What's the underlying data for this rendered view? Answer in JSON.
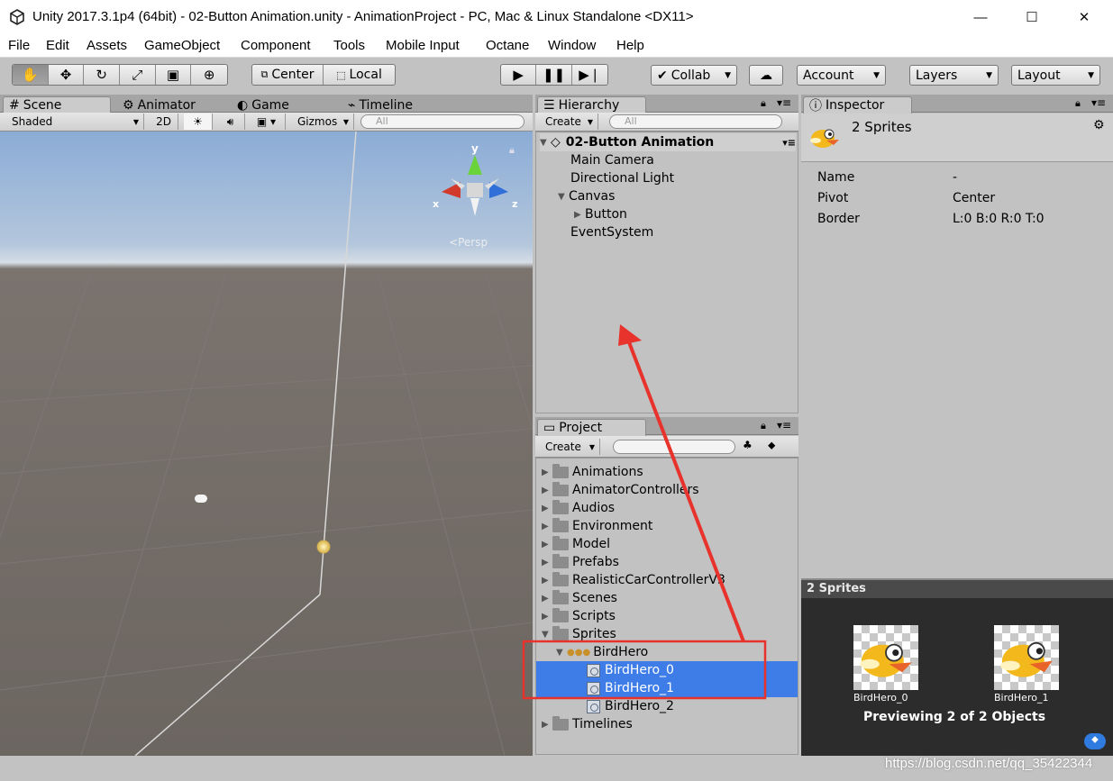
{
  "window": {
    "title": "Unity 2017.3.1p4 (64bit) - 02-Button Animation.unity - AnimationProject - PC, Mac & Linux Standalone <DX11>",
    "minimize": "—",
    "maximize": "☐",
    "close": "✕"
  },
  "menu": [
    "File",
    "Edit",
    "Assets",
    "GameObject",
    "Component",
    "Tools",
    "Mobile Input",
    "Octane",
    "Window",
    "Help"
  ],
  "toolbar": {
    "pivot": "Center",
    "space": "Local",
    "collab": "Collab",
    "account": "Account",
    "layers": "Layers",
    "layout": "Layout"
  },
  "scene": {
    "tabs": [
      "Scene",
      "Animator",
      "Game",
      "Timeline"
    ],
    "shading": "Shaded",
    "mode2d": "2D",
    "gizmos": "Gizmos",
    "search_placeholder": "All",
    "persp": "Persp",
    "axis_y": "y",
    "axis_x": "x",
    "axis_z": "z"
  },
  "hierarchy": {
    "tab": "Hierarchy",
    "create": "Create",
    "search_placeholder": "All",
    "scene_name": "02-Button Animation",
    "items": [
      "Main Camera",
      "Directional Light",
      "Canvas",
      "Button",
      "EventSystem"
    ]
  },
  "project": {
    "tab": "Project",
    "create": "Create",
    "folders": [
      "Animations",
      "AnimatorControllers",
      "Audios",
      "Environment",
      "Model",
      "Prefabs",
      "RealisticCarControllerV3",
      "Scenes",
      "Scripts",
      "Sprites"
    ],
    "sprite_sheet": "BirdHero",
    "sprites": [
      "BirdHero_0",
      "BirdHero_1",
      "BirdHero_2"
    ],
    "last_folder": "Timelines"
  },
  "inspector": {
    "tab": "Inspector",
    "header": "2 Sprites",
    "fields": [
      {
        "label": "Name",
        "value": "-"
      },
      {
        "label": "Pivot",
        "value": "Center"
      },
      {
        "label": "Border",
        "value": "L:0 B:0 R:0 T:0"
      }
    ],
    "preview_title": "2 Sprites",
    "preview_items": [
      "BirdHero_0",
      "BirdHero_1"
    ],
    "preview_caption": "Previewing 2 of 2 Objects"
  },
  "watermark": "https://blog.csdn.net/qq_35422344",
  "colors": {
    "selection": "#3e7de7",
    "annotation": "#e8322c",
    "sky": "#8fb0d8",
    "ground": "#6c6661"
  }
}
